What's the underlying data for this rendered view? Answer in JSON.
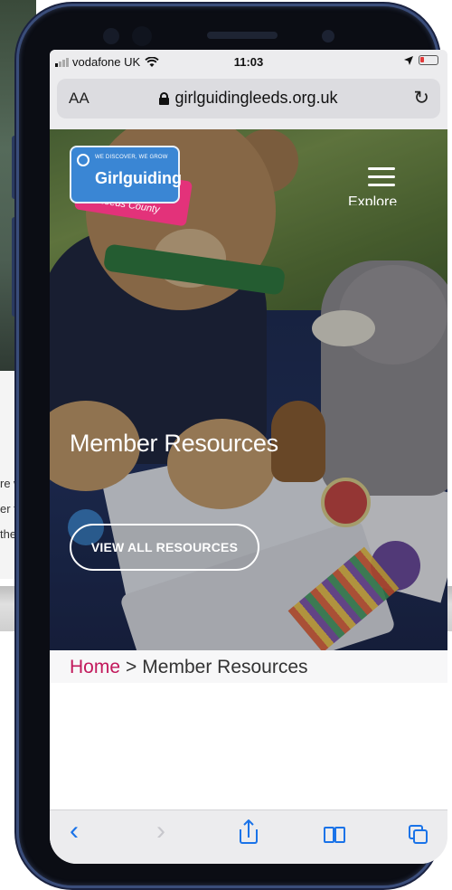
{
  "background": {
    "snippets": [
      "re we",
      "er the",
      "thei"
    ]
  },
  "status_bar": {
    "carrier": "vodafone UK",
    "time": "11:03",
    "wifi_icon": "wifi-icon",
    "location_icon": "location-arrow-icon",
    "battery_icon": "battery-low-icon"
  },
  "address_bar": {
    "text_size_label": "AA",
    "url": "girlguidingleeds.org.uk",
    "reload_icon": "reload-icon"
  },
  "hero": {
    "logo": {
      "tagline": "WE DISCOVER, WE GROW",
      "name": "Girlguiding",
      "county": "Leeds County"
    },
    "menu_label": "Explore",
    "title": "Member Resources",
    "button_label": "VIEW ALL RESOURCES"
  },
  "breadcrumb": {
    "home": "Home",
    "separator": ">",
    "current": "Member Resources"
  },
  "toolbar": {
    "back": "‹",
    "forward": "›"
  },
  "colors": {
    "brand_pink": "#e3327a",
    "brand_blue": "#3a86d4",
    "link_pink": "#c2185b",
    "ios_blue": "#1a73e8"
  }
}
